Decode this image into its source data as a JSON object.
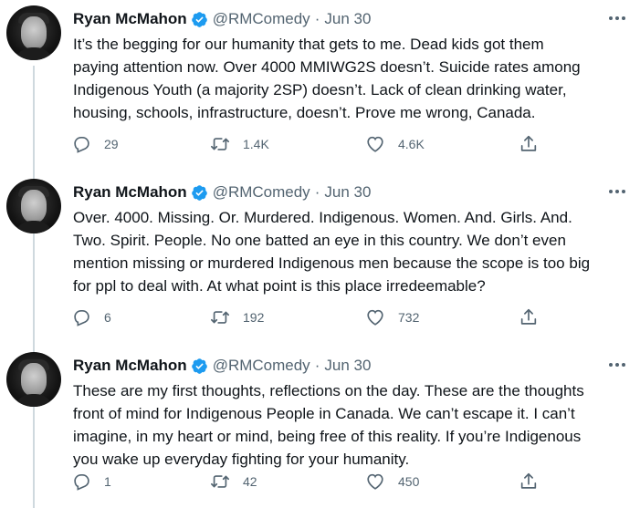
{
  "colors": {
    "text": "#0f1419",
    "secondary": "#536471",
    "verified": "#1d9bf0",
    "thread_line": "#cfd9de"
  },
  "icons": {
    "reply": "reply-icon",
    "retweet": "retweet-icon",
    "like": "like-icon",
    "share": "share-icon",
    "more": "more-icon",
    "verified": "verified-badge-icon"
  },
  "tweets": [
    {
      "author": "Ryan McMahon",
      "handle": "@RMComedy",
      "separator": "·",
      "date": "Jun 30",
      "lines": [
        "It’s the begging for our humanity that gets to me. Dead kids got them",
        "paying attention now. Over 4000 MMIWG2S doesn’t. Suicide rates among",
        "Indigenous Youth (a majority 2SP) doesn’t. Lack of clean drinking water,",
        "housing, schools, infrastructure, doesn’t. Prove me wrong, Canada."
      ],
      "replies": "29",
      "retweets": "1.4K",
      "likes": "4.6K"
    },
    {
      "author": "Ryan McMahon",
      "handle": "@RMComedy",
      "separator": "·",
      "date": "Jun 30",
      "lines": [
        "Over. 4000. Missing. Or. Murdered. Indigenous. Women. And. Girls. And.",
        "Two. Spirit. People. No one batted an eye in this country. We don’t even",
        "mention missing or murdered Indigenous men because the scope is too big",
        "for ppl to deal with. At what point is this place irredeemable?"
      ],
      "replies": "6",
      "retweets": "192",
      "likes": "732"
    },
    {
      "author": "Ryan McMahon",
      "handle": "@RMComedy",
      "separator": "·",
      "date": "Jun 30",
      "lines": [
        "These are my first thoughts, reflections on the day. These are the thoughts",
        "front of mind for Indigenous People in Canada. We can’t escape it. I can’t",
        "imagine, in my heart or mind, being free of this reality. If you’re Indigenous",
        "you wake up everyday fighting for your humanity."
      ],
      "replies": "1",
      "retweets": "42",
      "likes": "450"
    }
  ]
}
